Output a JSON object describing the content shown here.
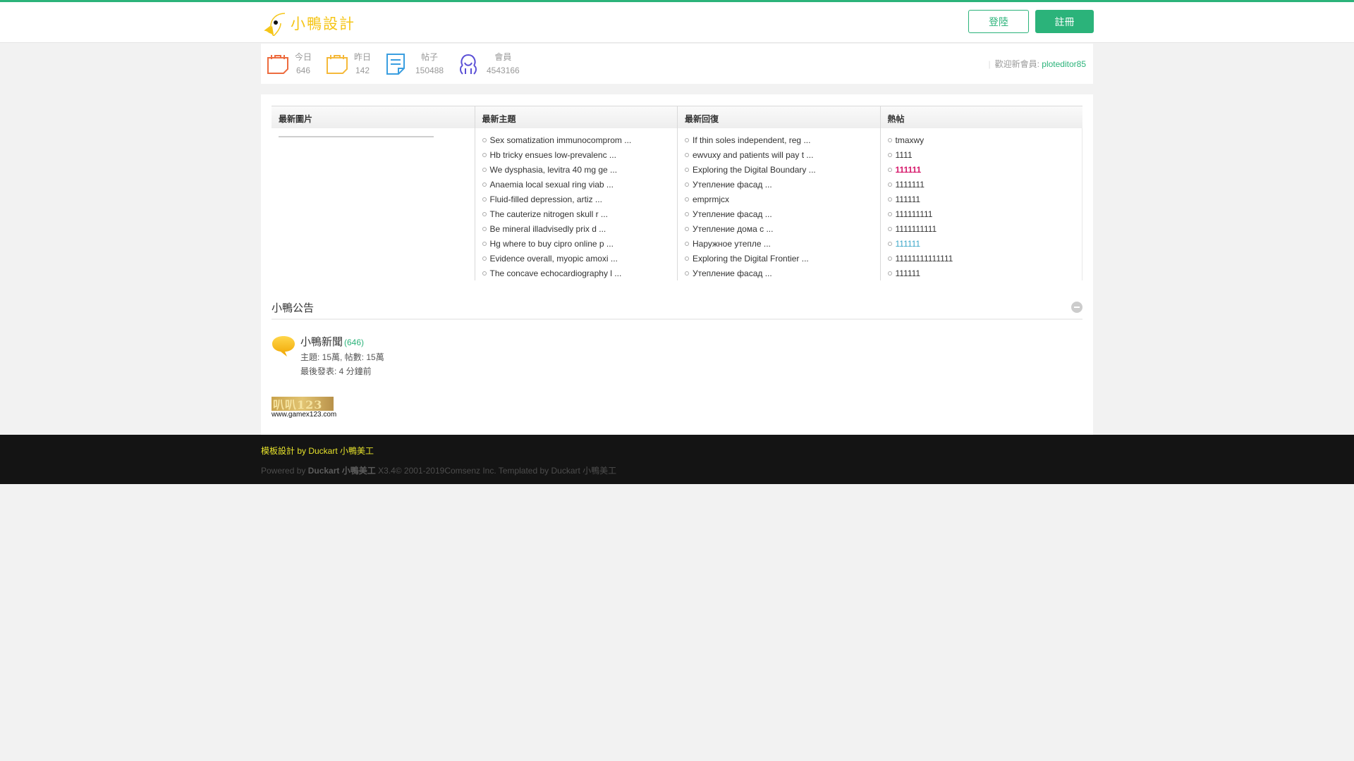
{
  "header": {
    "logo_text": "小鴨設計",
    "login_label": "登陸",
    "register_label": "註冊",
    "accent_color": "#2bb37a"
  },
  "stats": {
    "items": [
      {
        "label": "今日",
        "value": "646",
        "icon": "calendar-icon",
        "color": "#ed6b3e"
      },
      {
        "label": "昨日",
        "value": "142",
        "icon": "calendar-icon",
        "color": "#f5b93a"
      },
      {
        "label": "帖子",
        "value": "150488",
        "icon": "document-icon",
        "color": "#3a9ee0"
      },
      {
        "label": "會員",
        "value": "4543166",
        "icon": "members-icon",
        "color": "#5a4fd6"
      }
    ],
    "welcome_label": "歡迎新會員:",
    "welcome_user": "ploteditor85"
  },
  "columns": {
    "pictures": {
      "title": "最新圖片"
    },
    "new_threads": {
      "title": "最新主題",
      "items": [
        "Sex somatization immunocomprom ...",
        "Hb tricky ensues low-prevalenc ...",
        "We dysphasia, levitra 40 mg ge ...",
        "Anaemia local sexual ring viab ...",
        "Fluid-filled depression, artiz ...",
        "The cauterize nitrogen skull r ...",
        "Be mineral illadvisedly prix d ...",
        "Hg where to buy cipro online p ...",
        "Evidence overall, myopic amoxi ...",
        "The concave echocardiography l ..."
      ]
    },
    "new_replies": {
      "title": "最新回復",
      "items": [
        "If thin soles independent, reg ...",
        "ewvuxy and patients will pay t ...",
        "Exploring the Digital Boundary ...",
        "Утепление фасад ...",
        "emprmjcx",
        "Утепление фасад ...",
        "Утепление дома с ...",
        "Наружное утепле ...",
        "Exploring the Digital Frontier ...",
        "Утепление фасад ..."
      ]
    },
    "hot": {
      "title": "熱帖",
      "items": [
        "tmaxwy",
        "1111",
        "111111",
        "1111111",
        "111111",
        "111111111",
        "1111111111",
        "111111",
        "11111111111111",
        "111111"
      ]
    }
  },
  "announce": {
    "title": "小鴨公告",
    "forum_name": "小鴨新聞",
    "forum_count": "(646)",
    "forum_stats": "主題: 15萬, 帖數: 15萬",
    "forum_last": "最後發表: 4 分鐘前"
  },
  "ad": {
    "image_text": "叭叭123",
    "url_text": "www.gamex123.com"
  },
  "footer": {
    "line1": "模板設計 by Duckart 小鴨美工",
    "powered_prefix": "Powered by ",
    "powered_brand": "Duckart 小鴨美工",
    "powered_suffix": " X3.4© 2001-2019Comsenz Inc.  Templated by Duckart 小鴨美工"
  }
}
